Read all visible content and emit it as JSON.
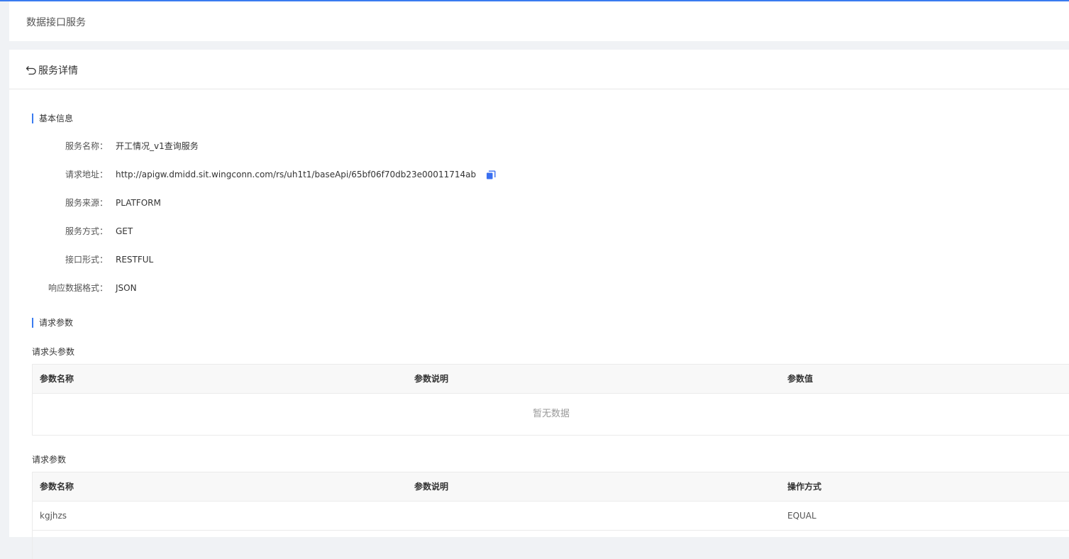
{
  "header": {
    "title": "数据接口服务"
  },
  "detail": {
    "title": "服务详情"
  },
  "basic": {
    "section_title": "基本信息",
    "rows": [
      {
        "label": "服务名称：",
        "value": "开工情况_v1查询服务"
      },
      {
        "label": "请求地址：",
        "value": "http://apigw.dmidd.sit.wingconn.com/rs/uh1t1/baseApi/65bf06f70db23e00011714ab"
      },
      {
        "label": "服务来源：",
        "value": "PLATFORM"
      },
      {
        "label": "服务方式：",
        "value": "GET"
      },
      {
        "label": "接口形式：",
        "value": "RESTFUL"
      },
      {
        "label": "响应数据格式：",
        "value": "JSON"
      }
    ]
  },
  "request": {
    "section_title": "请求参数",
    "header_params": {
      "title": "请求头参数",
      "columns": [
        "参数名称",
        "参数说明",
        "参数值"
      ],
      "empty_text": "暂无数据"
    },
    "query_params": {
      "title": "请求参数",
      "columns": [
        "参数名称",
        "参数说明",
        "操作方式"
      ],
      "rows": [
        {
          "name": "kgjhzs",
          "desc": "",
          "op": "EQUAL"
        }
      ]
    }
  },
  "colors": {
    "accent": "#3a7bf0",
    "copy_icon": "#3a6ff0"
  },
  "icons": {
    "back": "undo-arrow-icon",
    "copy": "copy-icon"
  }
}
